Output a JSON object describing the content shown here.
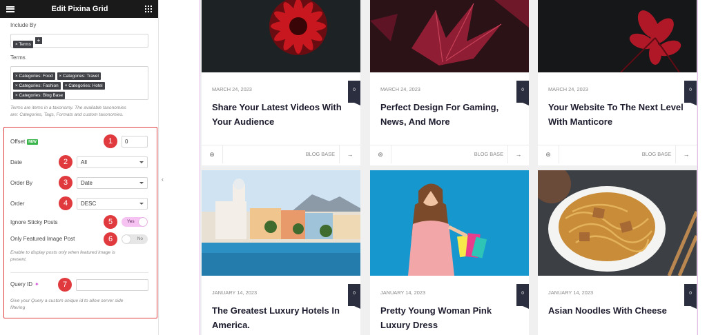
{
  "sidebar": {
    "title": "Edit Pixina Grid",
    "include_by": {
      "label": "Include By",
      "chip": "× Terms",
      "add": "+"
    },
    "terms": {
      "label": "Terms",
      "chips": [
        "× Categories: Food",
        "× Categories: Travel",
        "× Categories: Fashion",
        "× Categories: Hotel",
        "× Categories: Blog Base"
      ],
      "help_line1": "Terms are items in a taxonomy. The available taxonomies",
      "help_line2": "are: Categories, Tags, Formats and custom taxonomies."
    },
    "offset": {
      "label": "Offset",
      "badge": "NEW",
      "value": "0",
      "marker": "1"
    },
    "date": {
      "label": "Date",
      "value": "All",
      "marker": "2"
    },
    "order_by": {
      "label": "Order By",
      "value": "Date",
      "marker": "3"
    },
    "order": {
      "label": "Order",
      "value": "DESC",
      "marker": "4"
    },
    "sticky": {
      "label": "Ignore Sticky Posts",
      "value": "Yes",
      "marker": "5"
    },
    "featured": {
      "label": "Only Featured Image Post",
      "value": "No",
      "marker": "6",
      "help_line1": "Enable to display posts only when featured image is",
      "help_line2": "present."
    },
    "query_id": {
      "label": "Query ID",
      "value": "",
      "marker": "7",
      "help_line1": "Give your Query a custom unique id to allow server side",
      "help_line2": "filtering"
    },
    "highlight_color": "#e03a3e",
    "toggle_on_color": "#f6c2f2"
  },
  "posts": [
    {
      "date": "MARCH 24, 2023",
      "title": "Share Your Latest Videos With Your Audience",
      "comments": "0",
      "category": "BLOG BASE",
      "image": "red-flower-dark"
    },
    {
      "date": "MARCH 24, 2023",
      "title": "Perfect Design For Gaming, News, And More",
      "comments": "0",
      "category": "BLOG BASE",
      "image": "red-leaves-dark"
    },
    {
      "date": "MARCH 24, 2023",
      "title": "Your Website To The Next Level With Manticore",
      "comments": "0",
      "category": "BLOG BASE",
      "image": "red-plant-dark"
    },
    {
      "date": "JANUARY 14, 2023",
      "title": "The Greatest Luxury Hotels In America.",
      "comments": "0",
      "category": "",
      "image": "hotel-pool"
    },
    {
      "date": "JANUARY 14, 2023",
      "title": "Pretty Young Woman Pink Luxury Dress",
      "comments": "0",
      "category": "",
      "image": "woman-shopping-bags"
    },
    {
      "date": "JANUARY 14, 2023",
      "title": "Asian Noodles With Cheese",
      "comments": "0",
      "category": "",
      "image": "noodles-bowl"
    }
  ],
  "icons": {
    "author": "⊛",
    "arrow": "→",
    "collapse": "‹"
  }
}
